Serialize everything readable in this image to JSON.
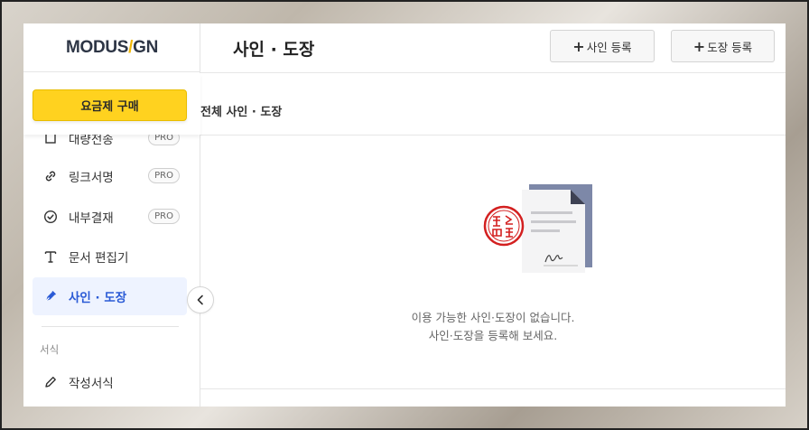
{
  "logo": {
    "left": "MODUS",
    "slash": "/",
    "right": "GN"
  },
  "header": {
    "title": "사인 · 도장",
    "add_sign_label": "사인 등록",
    "add_stamp_label": "도장 등록",
    "plus": "+"
  },
  "sidebar": {
    "buy_label": "요금제 구매",
    "items": [
      {
        "label": "대량전송",
        "badge": "PRO",
        "icon": "bulk-send-icon"
      },
      {
        "label": "링크서명",
        "badge": "PRO",
        "icon": "link-icon"
      },
      {
        "label": "내부결재",
        "badge": "PRO",
        "icon": "check-circle-icon"
      },
      {
        "label": "문서 편집기",
        "icon": "text-icon"
      },
      {
        "label": "사인 · 도장",
        "icon": "pen-icon",
        "active": true
      },
      {
        "label": "작성서식",
        "icon": "pencil-icon"
      }
    ],
    "section_label": "서식"
  },
  "main": {
    "filter_label": "전체 사인 · 도장",
    "empty_line1": "이용 가능한 사인·도장이 없습니다.",
    "empty_line2": "사인·도장을 등록해 보세요."
  },
  "colors": {
    "accent": "#2b5bd6",
    "buy": "#ffd21f",
    "stamp": "#d32020",
    "doc_fold": "#7d88a8"
  }
}
